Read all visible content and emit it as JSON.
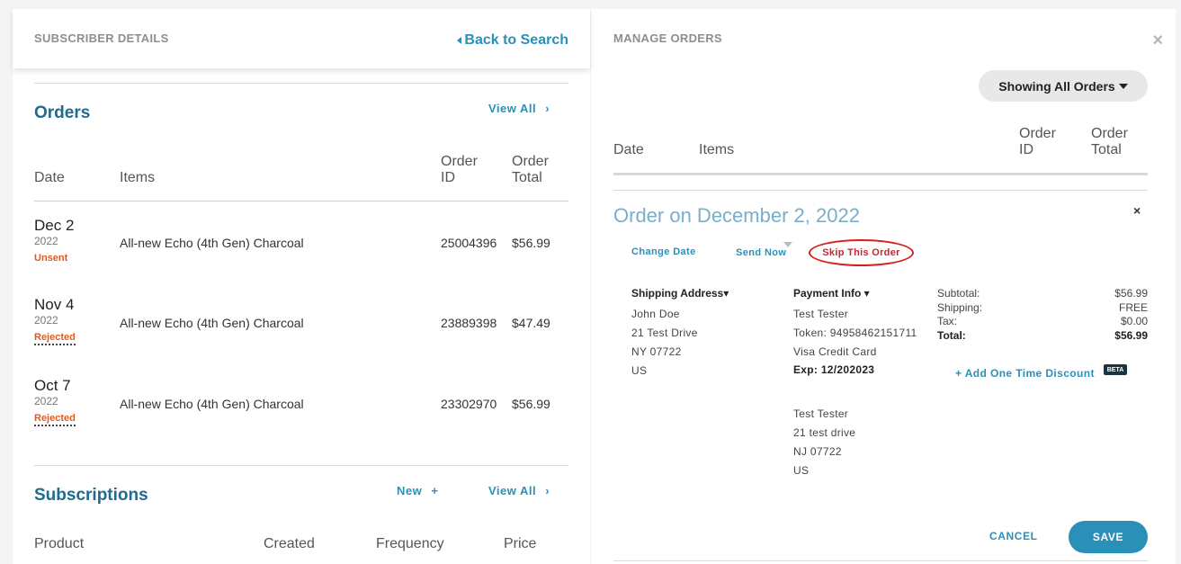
{
  "subscriber": {
    "header": "SUBSCRIBER DETAILS",
    "back_label": "Back to Search"
  },
  "orders": {
    "title": "Orders",
    "view_all": "View All",
    "chevron": "›",
    "columns": {
      "date": "Date",
      "items": "Items",
      "order_id_1": "Order",
      "order_id_2": "ID",
      "total_1": "Order",
      "total_2": "Total"
    },
    "rows": [
      {
        "date": "Dec 2",
        "year": "2022",
        "status": "Unsent",
        "item": "All-new Echo (4th Gen) Charcoal",
        "id": "25004396",
        "total": "$56.99"
      },
      {
        "date": "Nov 4",
        "year": "2022",
        "status": "Rejected",
        "item": "All-new Echo (4th Gen) Charcoal",
        "id": "23889398",
        "total": "$47.49"
      },
      {
        "date": "Oct 7",
        "year": "2022",
        "status": "Rejected",
        "item": "All-new Echo (4th Gen) Charcoal",
        "id": "23302970",
        "total": "$56.99"
      }
    ]
  },
  "subscriptions": {
    "title": "Subscriptions",
    "new_label": "New",
    "plus": "+",
    "view_all": "View All",
    "chevron": "›",
    "columns": {
      "product": "Product",
      "created": "Created",
      "frequency": "Frequency",
      "price": "Price"
    }
  },
  "manage": {
    "header": "MANAGE ORDERS",
    "close_icon": "×",
    "filter_label": "Showing All Orders",
    "columns": {
      "date": "Date",
      "items": "Items",
      "order_id_1": "Order",
      "order_id_2": "ID",
      "total_1": "Order",
      "total_2": "Total"
    },
    "order_title": "Order on December 2, 2022",
    "order_close": "×",
    "actions": {
      "change_date": "Change Date",
      "send_now": "Send Now",
      "skip": "Skip This Order"
    },
    "shipping": {
      "title": "Shipping Address▾",
      "lines": [
        "John Doe",
        "21 Test Drive",
        "NY 07722",
        "US"
      ]
    },
    "payment": {
      "title": "Payment Info ▾",
      "name": "Test Tester",
      "token": "Token: 94958462151711",
      "card": "Visa Credit Card",
      "exp": "Exp: 12/202023",
      "billing": [
        "Test Tester",
        "21 test drive",
        "NJ 07722",
        "US"
      ]
    },
    "summary": {
      "subtotal_label": "Subtotal:",
      "subtotal": "$56.99",
      "shipping_label": "Shipping:",
      "shipping": "FREE",
      "tax_label": "Tax:",
      "tax": "$0.00",
      "total_label": "Total:",
      "total": "$56.99"
    },
    "discount_label": "+ Add One Time Discount",
    "beta_badge": "BETA",
    "cancel_label": "CANCEL",
    "save_label": "SAVE"
  },
  "colors": {
    "accent": "#2b90b8",
    "heading": "#1f6b8f",
    "status_orange": "#e05a1c",
    "highlight_red": "#d61e1e"
  }
}
